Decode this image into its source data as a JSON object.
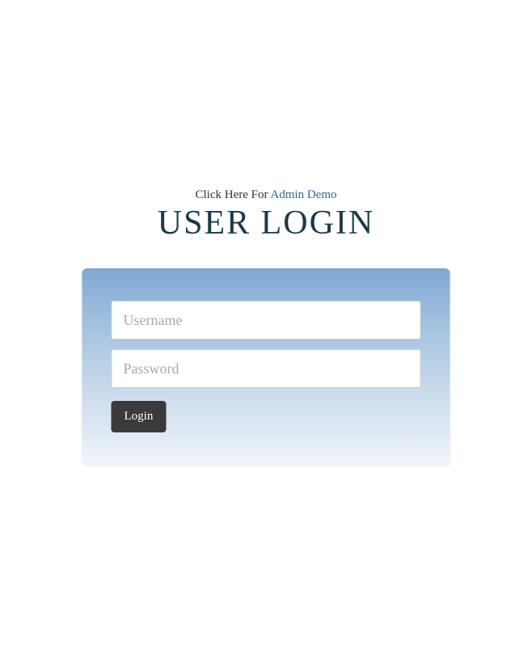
{
  "header": {
    "click_here_prefix": "Click Here For ",
    "admin_link_text": "Admin Demo",
    "title": "USER LOGIN"
  },
  "form": {
    "username_placeholder": "Username",
    "username_value": "",
    "password_placeholder": "Password",
    "password_value": "",
    "login_button_label": "Login"
  }
}
